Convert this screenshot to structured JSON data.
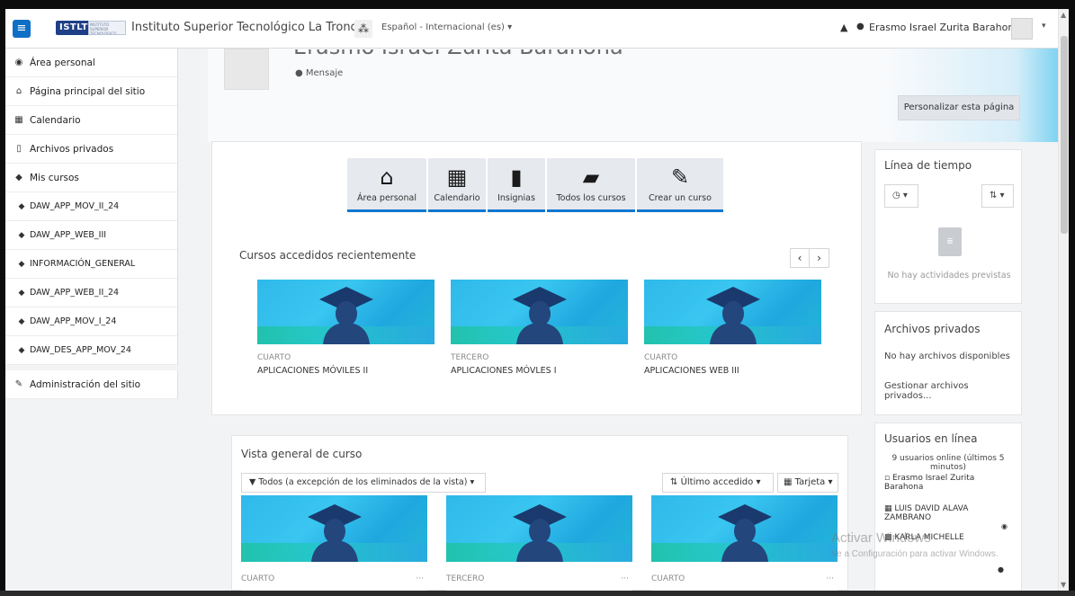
{
  "navbar": {
    "menu_icon": "hamburger-icon",
    "logo_text": "ISTLT",
    "logo_tagline": "INSTITUTO SUPERIOR TECNOLÓGICO",
    "site_name": "Instituto Superior Tecnológico La Troncal",
    "language": "Español - Internacional (es) ▾",
    "user_name": "Erasmo Israel Zurita Barahona",
    "bell_icon": "bell-icon",
    "chat_icon": "chat-icon",
    "caret": "▾"
  },
  "sidebar": {
    "items": [
      {
        "label": "Área personal",
        "icon": "dashboard-icon",
        "glyph": "◉"
      },
      {
        "label": "Página principal del sitio",
        "icon": "home-icon",
        "glyph": "⌂"
      },
      {
        "label": "Calendario",
        "icon": "calendar-icon",
        "glyph": "▦"
      },
      {
        "label": "Archivos privados",
        "icon": "file-icon",
        "glyph": "▯"
      },
      {
        "label": "Mis cursos",
        "icon": "graduation-cap-icon",
        "glyph": "◆"
      }
    ],
    "courses": [
      "DAW_APP_MOV_II_24",
      "DAW_APP_WEB_III",
      "INFORMACIÓN_GENERAL",
      "DAW_APP_WEB_II_24",
      "DAW_APP_MOV_I_24",
      "DAW_DES_APP_MOV_24"
    ],
    "admin": {
      "label": "Administración del sitio",
      "icon": "wrench-icon",
      "glyph": "✎"
    }
  },
  "profile": {
    "name": "Erasmo Israel Zurita Barahona",
    "message_label": "Mensaje",
    "customise_label": "Personalizar esta página"
  },
  "quicklinks": [
    {
      "label": "Área personal",
      "icon": "home-icon",
      "glyph": "⌂",
      "width": 88
    },
    {
      "label": "Calendario",
      "icon": "calendar-icon",
      "glyph": "▦",
      "width": 64
    },
    {
      "label": "Insignias",
      "icon": "bookmark-icon",
      "glyph": "▮",
      "width": 64
    },
    {
      "label": "Todos los cursos",
      "icon": "book-icon",
      "glyph": "▰",
      "width": 98
    },
    {
      "label": "Crear un curso",
      "icon": "edit-icon",
      "glyph": "✎",
      "width": 96
    }
  ],
  "recent": {
    "title": "Cursos accedidos recientemente",
    "prev": "‹",
    "next": "›",
    "courses": [
      {
        "category": "CUARTO",
        "name": "APLICACIONES MÓVILES II"
      },
      {
        "category": "TERCERO",
        "name": "APLICACIONES MÓVLES I"
      },
      {
        "category": "CUARTO",
        "name": "APLICACIONES WEB III"
      }
    ]
  },
  "overview": {
    "title": "Vista general de curso",
    "filter": "Todos (a excepción de los eliminados de la vista) ▾",
    "sort": "Último accedido ▾",
    "view": "Tarjeta ▾",
    "courses": [
      {
        "category": "CUARTO",
        "menu": "···"
      },
      {
        "category": "TERCERO",
        "menu": "···"
      },
      {
        "category": "CUARTO",
        "menu": "···"
      }
    ]
  },
  "timeline": {
    "title": "Línea de tiempo",
    "filter_label": "◷ ▾",
    "sort_label": "⇅ ▾",
    "empty": "No hay actividades previstas"
  },
  "private_files": {
    "title": "Archivos privados",
    "empty": "No hay archivos disponibles",
    "manage": "Gestionar archivos privados..."
  },
  "online_users": {
    "title": "Usuarios en línea",
    "summary": "9 usuarios online (últimos 5 minutos)",
    "users": [
      "Erasmo Israel Zurita Barahona",
      "LUIS DAVID ALAVA ZAMBRANO",
      "KARLA MICHELLE"
    ]
  },
  "windows_watermark": {
    "line1": "Activar Windows",
    "line2": "Ve a Configuración para activar Windows."
  },
  "colors": {
    "accent": "#1177d1",
    "course_image": "#2fb9ea"
  }
}
